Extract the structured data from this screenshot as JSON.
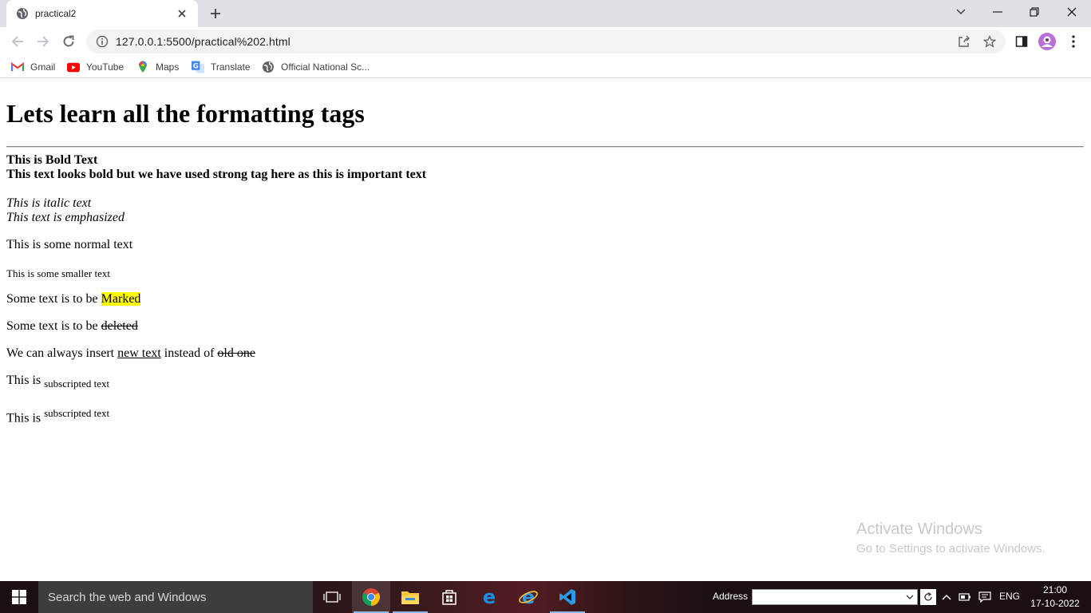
{
  "browser": {
    "tab_title": "practical2",
    "url": "127.0.0.1:5500/practical%202.html",
    "bookmarks": [
      "Gmail",
      "YouTube",
      "Maps",
      "Translate",
      "Official National Sc..."
    ]
  },
  "page": {
    "heading": "Lets learn all the formatting tags",
    "bold_text": "This is Bold Text",
    "strong_text": "This text looks bold but we have used strong tag here as this is important text",
    "italic_text": "This is italic text",
    "em_text": "This text is emphasized",
    "normal_text": "This is some normal text",
    "small_text": "This is some smaller text",
    "mark_prefix": "Some text is to be ",
    "mark_word": "Marked",
    "del_prefix": "Some text is to be ",
    "del_word": "deleted",
    "ins_prefix": "We can always insert ",
    "ins_word": "new text",
    "ins_middle": " instead of ",
    "ins_old": "old one",
    "sub_prefix": "This is ",
    "sub_word": "subscripted text",
    "sup_prefix": "This is ",
    "sup_word": "subscripted text"
  },
  "watermark": {
    "line1": "Activate Windows",
    "line2": "Go to Settings to activate Windows."
  },
  "taskbar": {
    "search_placeholder": "Search the web and Windows",
    "address_label": "Address",
    "language": "ENG",
    "time": "21:00",
    "date": "17-10-2022"
  },
  "colors": {
    "mark_highlight": "#ffff00",
    "tabstrip": "#dee1e6",
    "taskbar": "#1a1012"
  }
}
